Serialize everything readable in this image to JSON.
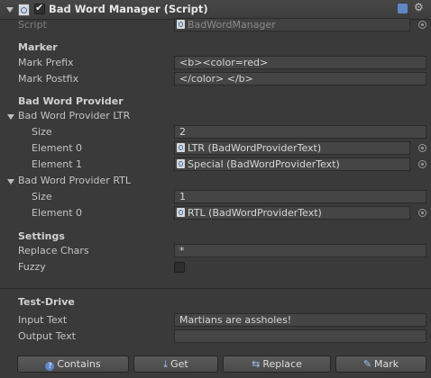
{
  "component": {
    "title": "Bad Word Manager (Script)",
    "enabled": true
  },
  "script_row": {
    "label": "Script",
    "value": "BadWordManager"
  },
  "marker": {
    "header": "Marker",
    "prefix_label": "Mark Prefix",
    "prefix_value": "<b><color=red>",
    "postfix_label": "Mark Postfix",
    "postfix_value": "</color> </b>"
  },
  "provider": {
    "header": "Bad Word Provider",
    "ltr": {
      "label": "Bad Word Provider LTR",
      "size_label": "Size",
      "size_value": "2",
      "elements": [
        {
          "label": "Element 0",
          "value": "LTR (BadWordProviderText)"
        },
        {
          "label": "Element 1",
          "value": "Special (BadWordProviderText)"
        }
      ]
    },
    "rtl": {
      "label": "Bad Word Provider RTL",
      "size_label": "Size",
      "size_value": "1",
      "elements": [
        {
          "label": "Element 0",
          "value": "RTL (BadWordProviderText)"
        }
      ]
    }
  },
  "settings": {
    "header": "Settings",
    "replace_label": "Replace Chars",
    "replace_value": "*",
    "fuzzy_label": "Fuzzy",
    "fuzzy_checked": false
  },
  "test_drive": {
    "header": "Test-Drive",
    "input_label": "Input Text",
    "input_value": "Martians are assholes!",
    "output_label": "Output Text",
    "output_value": ""
  },
  "buttons": {
    "contains": {
      "label": "Contains",
      "icon": "question-icon"
    },
    "get": {
      "label": "Get",
      "icon": "download-icon"
    },
    "replace": {
      "label": "Replace",
      "icon": "swap-arrows-icon"
    },
    "mark": {
      "label": "Mark",
      "icon": "pencil-icon"
    }
  },
  "colors": {
    "background": "#3a3a3a",
    "field": "#454545",
    "accent_icon": "#9fc4f0"
  }
}
